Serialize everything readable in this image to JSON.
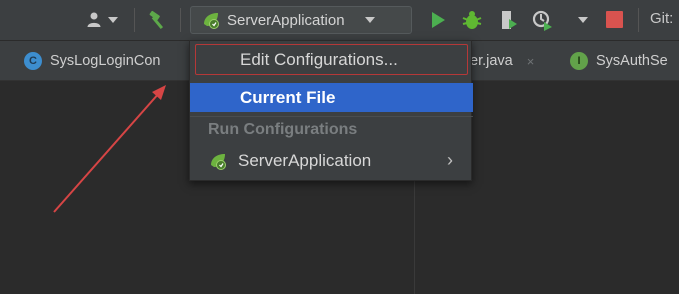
{
  "toolbar": {
    "run_config_label": "ServerApplication",
    "git_label": "Git:",
    "icons": [
      "user-icon",
      "hammer-icon",
      "spring-boot-icon",
      "run-icon",
      "debug-icon",
      "coverage-icon",
      "profiler-icon",
      "stop-icon"
    ],
    "colors": {
      "run": "#4caf50",
      "debug": "#5fb832",
      "stop": "#d9534f"
    }
  },
  "tabs": [
    {
      "label": "SysLogLoginCon",
      "icon": "class-icon"
    },
    {
      "label": "er.java",
      "icon": "",
      "close": "×"
    },
    {
      "label": "SysAuthSe",
      "icon": "interface-icon"
    }
  ],
  "dropdown": {
    "edit_configurations": "Edit Configurations...",
    "current_file": "Current File",
    "section_label": "Run Configurations",
    "server_application": "ServerApplication",
    "submenu_chevron": "›"
  },
  "annotation": {
    "color": "#d64545"
  }
}
